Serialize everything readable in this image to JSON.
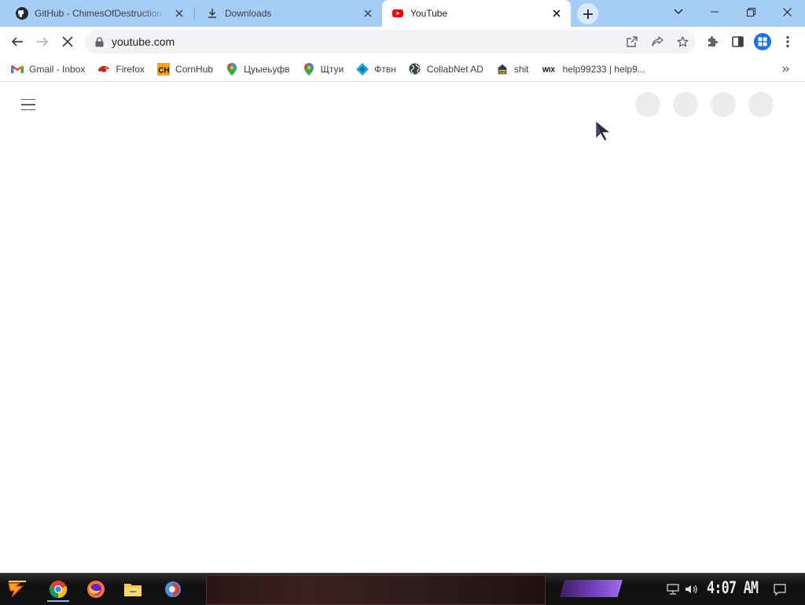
{
  "browser": {
    "tabs": [
      {
        "title": "GitHub - ChimesOfDestruction",
        "favicon": "github-icon",
        "active": false
      },
      {
        "title": "Downloads",
        "favicon": "download-icon",
        "active": false
      },
      {
        "title": "YouTube",
        "favicon": "youtube-icon",
        "active": true
      }
    ],
    "address": {
      "url": "youtube.com"
    },
    "bookmarks": [
      {
        "label": "Gmail - Inbox",
        "icon": "gmail-icon"
      },
      {
        "label": "Firefox",
        "icon": "firefox-icon"
      },
      {
        "label": "CornHub",
        "icon": "cornhub-icon"
      },
      {
        "label": "Цуыеьуфв",
        "icon": "maps-pin-icon"
      },
      {
        "label": "Щтуи",
        "icon": "maps-pin-icon"
      },
      {
        "label": "Фтвн",
        "icon": "diamond-icon"
      },
      {
        "label": "CollabNet AD",
        "icon": "globe-icon"
      },
      {
        "label": "shit",
        "icon": "hfs-icon"
      },
      {
        "label": "help99233 | help9...",
        "icon": "wix-icon"
      }
    ]
  },
  "taskbar": {
    "clock": "4:07 AM"
  },
  "colors": {
    "tabstrip": "#a6cdf6",
    "accent": "#1a73e8",
    "youtube_red": "#ff0000"
  }
}
